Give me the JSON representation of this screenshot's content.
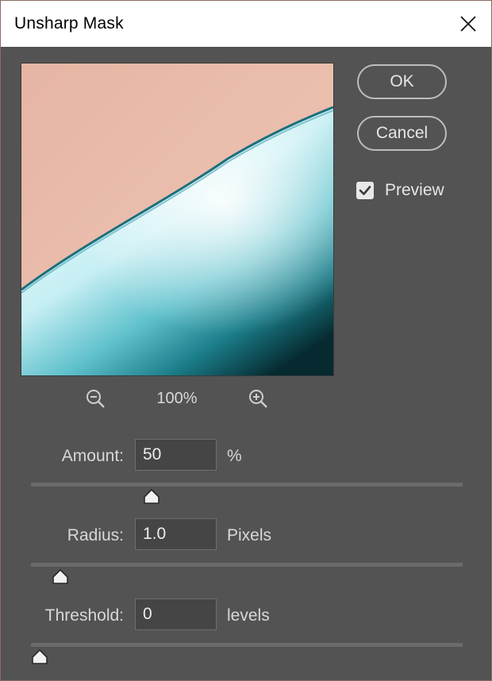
{
  "window": {
    "title": "Unsharp Mask"
  },
  "buttons": {
    "ok_label": "OK",
    "cancel_label": "Cancel"
  },
  "preview": {
    "checkbox_label": "Preview",
    "checked": true,
    "zoom": "100%",
    "colors": {
      "skin": "#e7b8a6",
      "edge": "#1f7f8c",
      "cyan_light": "#dff8fb",
      "cyan_dark": "#0a2f35"
    }
  },
  "params": {
    "amount": {
      "label": "Amount:",
      "value": "50",
      "unit": "%",
      "slider_fraction": 0.27
    },
    "radius": {
      "label": "Radius:",
      "value": "1.0",
      "unit": "Pixels",
      "slider_fraction": 0.05
    },
    "threshold": {
      "label": "Threshold:",
      "value": "0",
      "unit": "levels",
      "slider_fraction": 0.0
    }
  },
  "icons": {
    "close": "close-icon",
    "zoom_out": "zoom-out-icon",
    "zoom_in": "zoom-in-icon",
    "check": "check-icon",
    "slider_thumb": "slider-thumb-icon"
  }
}
